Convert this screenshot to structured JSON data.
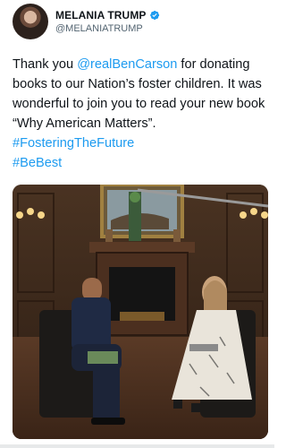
{
  "account": {
    "display_name": "MELANIA TRUMP",
    "handle": "@MELANIATRUMP",
    "verified_icon": "verified-badge-icon",
    "badge_color": "#1d9bf0"
  },
  "tweet": {
    "text_1": "Thank you ",
    "mention": "@realBenCarson",
    "text_2": " for donating books to our Nation’s foster children. It was wonderful to join you to read your new book “Why American Matters”. ",
    "hashtag_1": "#FosteringTheFuture",
    "hashtag_2": "#BeBest",
    "link_color": "#1d9bf0"
  },
  "media": {
    "image": "photo of two people seated in armchairs in a wood-paneled room with a fireplace and painting"
  }
}
